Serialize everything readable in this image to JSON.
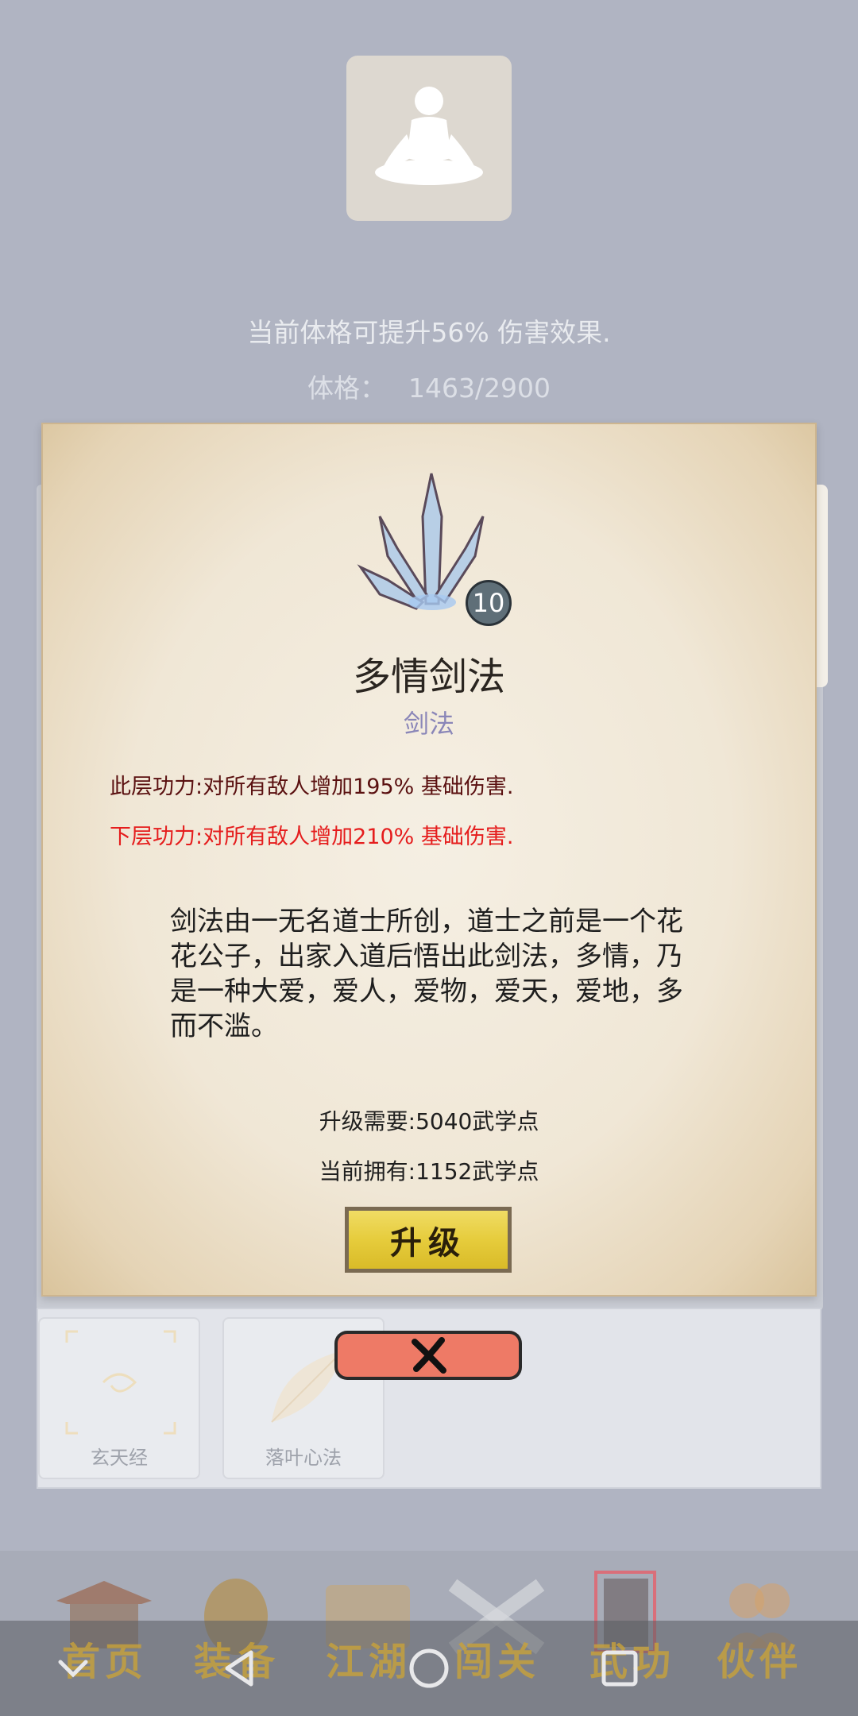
{
  "status": {
    "damage_text": "当前体格可提升56% 伤害效果.",
    "body_label": "体格：",
    "body_value": "1463/2900"
  },
  "skill": {
    "level": "10",
    "name": "多情剑法",
    "type": "剑法",
    "current_layer": "此层功力:对所有敌人增加195% 基础伤害.",
    "next_layer": "下层功力:对所有敌人增加210% 基础伤害.",
    "description": "剑法由一无名道士所创，道士之前是一个花花公子，出家入道后悟出此剑法，多情，乃是一种大爱，爱人，爱物，爱天，爱地，多而不滥。",
    "upgrade_required": "升级需要:5040武学点",
    "points_owned": "当前拥有:1152武学点",
    "upgrade_button": "升级"
  },
  "skill_list": [
    {
      "label": "玄天经"
    },
    {
      "label": "落叶心法"
    }
  ],
  "bottom_nav": [
    {
      "label": "首页",
      "icon": "temple-icon"
    },
    {
      "label": "装备",
      "icon": "armor-icon"
    },
    {
      "label": "江湖",
      "icon": "scroll-map-icon"
    },
    {
      "label": "闯关",
      "icon": "crossed-swords-icon"
    },
    {
      "label": "武功",
      "icon": "book-icon"
    },
    {
      "label": "伙伴",
      "icon": "partners-icon"
    }
  ],
  "colors": {
    "next_layer": "#e51d1d",
    "current_layer": "#5a1010",
    "skill_type": "#8a86b8",
    "upgrade_button": "#e6cc3c",
    "close_button": "#ee7a66"
  }
}
